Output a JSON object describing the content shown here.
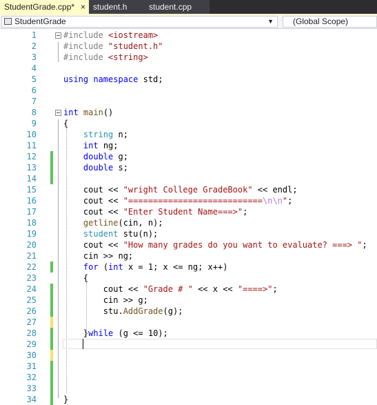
{
  "tabs": [
    {
      "label": "StudentGrade.cpp*",
      "close": "×"
    },
    {
      "label": "student.h"
    },
    {
      "label": "student.cpp"
    }
  ],
  "navbar": {
    "project": "StudentGrade",
    "scope": "(Global Scope)"
  },
  "colors": {
    "keyword": "#0000ff",
    "type": "#2b91af",
    "string": "#a31515",
    "function": "#74531f",
    "escape": "#b776fb",
    "text": "#000000",
    "line_number": "#2b91af",
    "change_saved": "#5fc45a",
    "change_unsaved": "#f5e36a"
  },
  "lines": [
    {
      "n": "1",
      "change": "",
      "fold": true,
      "tokens": [
        {
          "t": "#include ",
          "c": "d"
        },
        {
          "t": "<iostream>",
          "c": "s"
        }
      ]
    },
    {
      "n": "2",
      "change": "",
      "fold": false,
      "tokens": [
        {
          "t": "#include ",
          "c": "d"
        },
        {
          "t": "\"student.h\"",
          "c": "s"
        }
      ]
    },
    {
      "n": "3",
      "change": "",
      "fold": false,
      "tokens": [
        {
          "t": "#include ",
          "c": "d"
        },
        {
          "t": "<string>",
          "c": "s"
        }
      ]
    },
    {
      "n": "4",
      "change": "",
      "fold": false,
      "tokens": []
    },
    {
      "n": "5",
      "change": "",
      "fold": false,
      "tokens": [
        {
          "t": "using namespace ",
          "c": "k"
        },
        {
          "t": "std;",
          "c": "p"
        }
      ]
    },
    {
      "n": "6",
      "change": "",
      "fold": false,
      "tokens": []
    },
    {
      "n": "7",
      "change": "",
      "fold": false,
      "tokens": []
    },
    {
      "n": "8",
      "change": "",
      "fold": true,
      "tokens": [
        {
          "t": "int ",
          "c": "k"
        },
        {
          "t": "main",
          "c": "f"
        },
        {
          "t": "()",
          "c": "p"
        }
      ]
    },
    {
      "n": "9",
      "change": "",
      "fold": false,
      "tokens": [
        {
          "t": "{",
          "c": "p"
        }
      ]
    },
    {
      "n": "10",
      "change": "",
      "fold": false,
      "tokens": [
        {
          "t": "    "
        },
        {
          "t": "string ",
          "c": "t"
        },
        {
          "t": "n;",
          "c": "p"
        }
      ]
    },
    {
      "n": "11",
      "change": "",
      "fold": false,
      "tokens": [
        {
          "t": "    "
        },
        {
          "t": "int ",
          "c": "k"
        },
        {
          "t": "ng;",
          "c": "p"
        }
      ]
    },
    {
      "n": "12",
      "change": "green",
      "fold": false,
      "tokens": [
        {
          "t": "    "
        },
        {
          "t": "double ",
          "c": "k"
        },
        {
          "t": "g;",
          "c": "p"
        }
      ]
    },
    {
      "n": "13",
      "change": "green",
      "fold": false,
      "tokens": [
        {
          "t": "    "
        },
        {
          "t": "double ",
          "c": "k"
        },
        {
          "t": "s;",
          "c": "p"
        }
      ]
    },
    {
      "n": "14",
      "change": "green",
      "fold": false,
      "tokens": []
    },
    {
      "n": "15",
      "change": "",
      "fold": false,
      "tokens": [
        {
          "t": "    "
        },
        {
          "t": "cout << ",
          "c": "p"
        },
        {
          "t": "\"wright College GradeBook\"",
          "c": "s"
        },
        {
          "t": " << endl;",
          "c": "p"
        }
      ]
    },
    {
      "n": "16",
      "change": "",
      "fold": false,
      "tokens": [
        {
          "t": "    "
        },
        {
          "t": "cout << ",
          "c": "p"
        },
        {
          "t": "\"===========================",
          "c": "s"
        },
        {
          "t": "\\n\\n",
          "c": "e"
        },
        {
          "t": "\"",
          "c": "s"
        },
        {
          "t": ";",
          "c": "p"
        }
      ]
    },
    {
      "n": "17",
      "change": "",
      "fold": false,
      "tokens": [
        {
          "t": "    "
        },
        {
          "t": "cout << ",
          "c": "p"
        },
        {
          "t": "\"Enter Student Name===>\"",
          "c": "s"
        },
        {
          "t": ";",
          "c": "p"
        }
      ]
    },
    {
      "n": "18",
      "change": "",
      "fold": false,
      "tokens": [
        {
          "t": "    "
        },
        {
          "t": "getline",
          "c": "f"
        },
        {
          "t": "(cin, n);",
          "c": "p"
        }
      ]
    },
    {
      "n": "19",
      "change": "",
      "fold": false,
      "tokens": [
        {
          "t": "    "
        },
        {
          "t": "student ",
          "c": "t"
        },
        {
          "t": "stu(n);",
          "c": "p"
        }
      ]
    },
    {
      "n": "20",
      "change": "",
      "fold": false,
      "tokens": [
        {
          "t": "    "
        },
        {
          "t": "cout << ",
          "c": "p"
        },
        {
          "t": "\"How many grades do you want to evaluate? ===> \"",
          "c": "s"
        },
        {
          "t": ";",
          "c": "p"
        }
      ]
    },
    {
      "n": "21",
      "change": "",
      "fold": false,
      "tokens": [
        {
          "t": "    "
        },
        {
          "t": "cin >> ng;",
          "c": "p"
        }
      ]
    },
    {
      "n": "22",
      "change": "green",
      "fold": false,
      "tokens": [
        {
          "t": "    "
        },
        {
          "t": "for ",
          "c": "k"
        },
        {
          "t": "(",
          "c": "p"
        },
        {
          "t": "int ",
          "c": "k"
        },
        {
          "t": "x = 1; x <= ng; x++)",
          "c": "p"
        }
      ]
    },
    {
      "n": "23",
      "change": "",
      "fold": false,
      "tokens": [
        {
          "t": "    "
        },
        {
          "t": "{",
          "c": "p"
        }
      ]
    },
    {
      "n": "24",
      "change": "green",
      "fold": false,
      "tokens": [
        {
          "t": "        "
        },
        {
          "t": "cout << ",
          "c": "p"
        },
        {
          "t": "\"Grade # \"",
          "c": "s"
        },
        {
          "t": " << x << ",
          "c": "p"
        },
        {
          "t": "\"====>\"",
          "c": "s"
        },
        {
          "t": ";",
          "c": "p"
        }
      ]
    },
    {
      "n": "25",
      "change": "green",
      "fold": false,
      "tokens": [
        {
          "t": "        "
        },
        {
          "t": "cin >> g;",
          "c": "p"
        }
      ]
    },
    {
      "n": "26",
      "change": "green",
      "fold": false,
      "tokens": [
        {
          "t": "        "
        },
        {
          "t": "stu.",
          "c": "p"
        },
        {
          "t": "AddGrade",
          "c": "f"
        },
        {
          "t": "(g);",
          "c": "p"
        }
      ]
    },
    {
      "n": "27",
      "change": "yellow",
      "fold": false,
      "tokens": []
    },
    {
      "n": "28",
      "change": "green",
      "fold": false,
      "tokens": [
        {
          "t": "    "
        },
        {
          "t": "}",
          "c": "p"
        },
        {
          "t": "while ",
          "c": "k"
        },
        {
          "t": "(g <= 10);",
          "c": "p"
        }
      ]
    },
    {
      "n": "29",
      "change": "green",
      "fold": false,
      "tokens": []
    },
    {
      "n": "30",
      "change": "yellow",
      "fold": false,
      "tokens": []
    },
    {
      "n": "31",
      "change": "green",
      "fold": false,
      "tokens": []
    },
    {
      "n": "32",
      "change": "green",
      "fold": false,
      "tokens": []
    },
    {
      "n": "33",
      "change": "green",
      "fold": false,
      "tokens": []
    },
    {
      "n": "34",
      "change": "green",
      "fold": false,
      "tokens": [
        {
          "t": "}",
          "c": "p"
        }
      ]
    }
  ]
}
